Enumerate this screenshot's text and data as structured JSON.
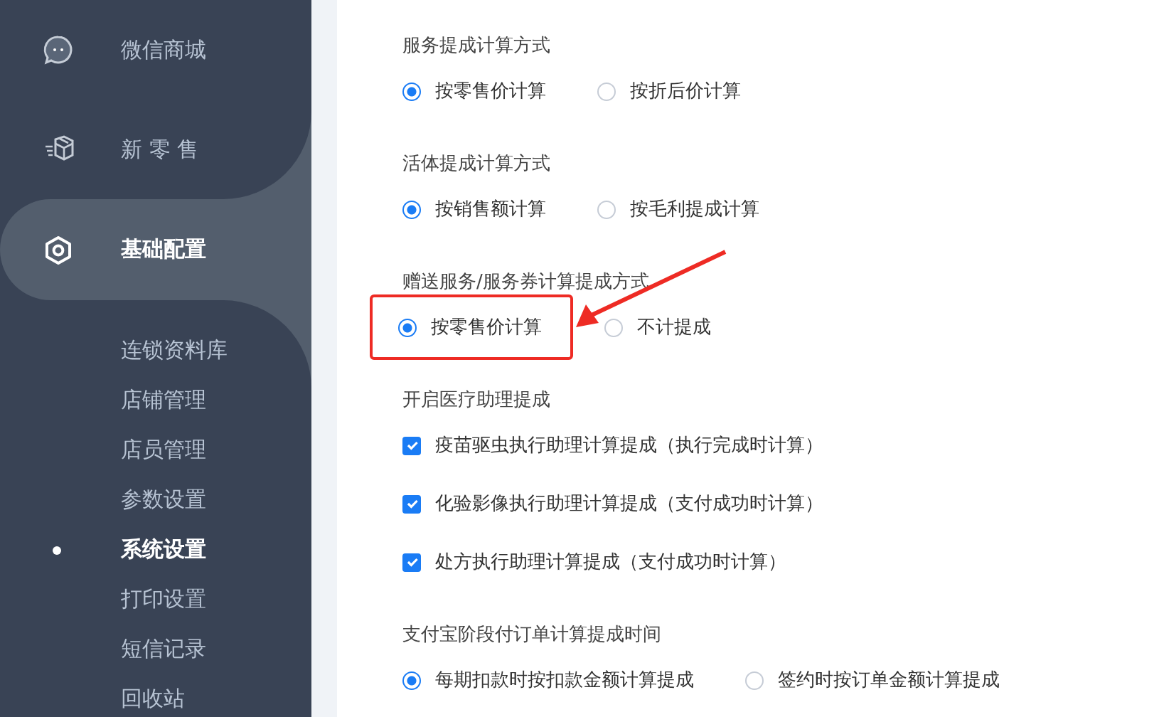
{
  "sidebar": {
    "items": [
      {
        "label": "微信商城",
        "selected": false
      },
      {
        "label": "新 零 售",
        "selected": false
      },
      {
        "label": "基础配置",
        "selected": true,
        "children": [
          {
            "label": "连锁资料库",
            "selected": false
          },
          {
            "label": "店铺管理",
            "selected": false
          },
          {
            "label": "店员管理",
            "selected": false
          },
          {
            "label": "参数设置",
            "selected": false
          },
          {
            "label": "系统设置",
            "selected": true
          },
          {
            "label": "打印设置",
            "selected": false
          },
          {
            "label": "短信记录",
            "selected": false
          },
          {
            "label": "回收站",
            "selected": false
          }
        ]
      }
    ]
  },
  "sections": [
    {
      "title": "服务提成计算方式",
      "kind": "radio",
      "options": [
        {
          "label": "按零售价计算",
          "selected": true,
          "highlighted": false
        },
        {
          "label": "按折后价计算",
          "selected": false,
          "highlighted": false
        }
      ]
    },
    {
      "title": "活体提成计算方式",
      "kind": "radio",
      "options": [
        {
          "label": "按销售额计算",
          "selected": true,
          "highlighted": false
        },
        {
          "label": "按毛利提成计算",
          "selected": false,
          "highlighted": false
        }
      ]
    },
    {
      "title": "赠送服务/服务券计算提成方式",
      "kind": "radio",
      "options": [
        {
          "label": "按零售价计算",
          "selected": true,
          "highlighted": true
        },
        {
          "label": "不计提成",
          "selected": false,
          "highlighted": false
        }
      ]
    },
    {
      "title": "开启医疗助理提成",
      "kind": "checkbox",
      "options": [
        {
          "label": "疫苗驱虫执行助理计算提成（执行完成时计算）",
          "checked": true
        },
        {
          "label": "化验影像执行助理计算提成（支付成功时计算）",
          "checked": true
        },
        {
          "label": "处方执行助理计算提成（支付成功时计算）",
          "checked": true
        }
      ]
    },
    {
      "title": "支付宝阶段付订单计算提成时间",
      "kind": "radio",
      "options": [
        {
          "label": "每期扣款时按扣款金额计算提成",
          "selected": true,
          "highlighted": false
        },
        {
          "label": "签约时按订单金额计算提成",
          "selected": false,
          "highlighted": false
        }
      ]
    }
  ]
}
